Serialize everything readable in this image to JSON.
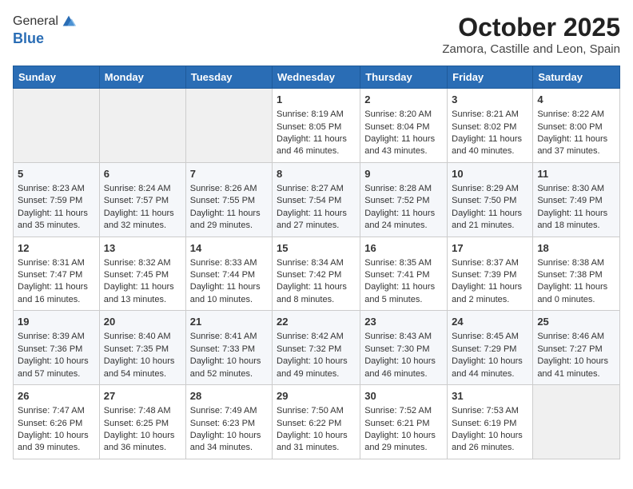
{
  "header": {
    "logo_line1": "General",
    "logo_line2": "Blue",
    "month": "October 2025",
    "location": "Zamora, Castille and Leon, Spain"
  },
  "weekdays": [
    "Sunday",
    "Monday",
    "Tuesday",
    "Wednesday",
    "Thursday",
    "Friday",
    "Saturday"
  ],
  "weeks": [
    [
      {
        "day": "",
        "sunrise": "",
        "sunset": "",
        "daylight": ""
      },
      {
        "day": "",
        "sunrise": "",
        "sunset": "",
        "daylight": ""
      },
      {
        "day": "",
        "sunrise": "",
        "sunset": "",
        "daylight": ""
      },
      {
        "day": "1",
        "sunrise": "Sunrise: 8:19 AM",
        "sunset": "Sunset: 8:05 PM",
        "daylight": "Daylight: 11 hours and 46 minutes."
      },
      {
        "day": "2",
        "sunrise": "Sunrise: 8:20 AM",
        "sunset": "Sunset: 8:04 PM",
        "daylight": "Daylight: 11 hours and 43 minutes."
      },
      {
        "day": "3",
        "sunrise": "Sunrise: 8:21 AM",
        "sunset": "Sunset: 8:02 PM",
        "daylight": "Daylight: 11 hours and 40 minutes."
      },
      {
        "day": "4",
        "sunrise": "Sunrise: 8:22 AM",
        "sunset": "Sunset: 8:00 PM",
        "daylight": "Daylight: 11 hours and 37 minutes."
      }
    ],
    [
      {
        "day": "5",
        "sunrise": "Sunrise: 8:23 AM",
        "sunset": "Sunset: 7:59 PM",
        "daylight": "Daylight: 11 hours and 35 minutes."
      },
      {
        "day": "6",
        "sunrise": "Sunrise: 8:24 AM",
        "sunset": "Sunset: 7:57 PM",
        "daylight": "Daylight: 11 hours and 32 minutes."
      },
      {
        "day": "7",
        "sunrise": "Sunrise: 8:26 AM",
        "sunset": "Sunset: 7:55 PM",
        "daylight": "Daylight: 11 hours and 29 minutes."
      },
      {
        "day": "8",
        "sunrise": "Sunrise: 8:27 AM",
        "sunset": "Sunset: 7:54 PM",
        "daylight": "Daylight: 11 hours and 27 minutes."
      },
      {
        "day": "9",
        "sunrise": "Sunrise: 8:28 AM",
        "sunset": "Sunset: 7:52 PM",
        "daylight": "Daylight: 11 hours and 24 minutes."
      },
      {
        "day": "10",
        "sunrise": "Sunrise: 8:29 AM",
        "sunset": "Sunset: 7:50 PM",
        "daylight": "Daylight: 11 hours and 21 minutes."
      },
      {
        "day": "11",
        "sunrise": "Sunrise: 8:30 AM",
        "sunset": "Sunset: 7:49 PM",
        "daylight": "Daylight: 11 hours and 18 minutes."
      }
    ],
    [
      {
        "day": "12",
        "sunrise": "Sunrise: 8:31 AM",
        "sunset": "Sunset: 7:47 PM",
        "daylight": "Daylight: 11 hours and 16 minutes."
      },
      {
        "day": "13",
        "sunrise": "Sunrise: 8:32 AM",
        "sunset": "Sunset: 7:45 PM",
        "daylight": "Daylight: 11 hours and 13 minutes."
      },
      {
        "day": "14",
        "sunrise": "Sunrise: 8:33 AM",
        "sunset": "Sunset: 7:44 PM",
        "daylight": "Daylight: 11 hours and 10 minutes."
      },
      {
        "day": "15",
        "sunrise": "Sunrise: 8:34 AM",
        "sunset": "Sunset: 7:42 PM",
        "daylight": "Daylight: 11 hours and 8 minutes."
      },
      {
        "day": "16",
        "sunrise": "Sunrise: 8:35 AM",
        "sunset": "Sunset: 7:41 PM",
        "daylight": "Daylight: 11 hours and 5 minutes."
      },
      {
        "day": "17",
        "sunrise": "Sunrise: 8:37 AM",
        "sunset": "Sunset: 7:39 PM",
        "daylight": "Daylight: 11 hours and 2 minutes."
      },
      {
        "day": "18",
        "sunrise": "Sunrise: 8:38 AM",
        "sunset": "Sunset: 7:38 PM",
        "daylight": "Daylight: 11 hours and 0 minutes."
      }
    ],
    [
      {
        "day": "19",
        "sunrise": "Sunrise: 8:39 AM",
        "sunset": "Sunset: 7:36 PM",
        "daylight": "Daylight: 10 hours and 57 minutes."
      },
      {
        "day": "20",
        "sunrise": "Sunrise: 8:40 AM",
        "sunset": "Sunset: 7:35 PM",
        "daylight": "Daylight: 10 hours and 54 minutes."
      },
      {
        "day": "21",
        "sunrise": "Sunrise: 8:41 AM",
        "sunset": "Sunset: 7:33 PM",
        "daylight": "Daylight: 10 hours and 52 minutes."
      },
      {
        "day": "22",
        "sunrise": "Sunrise: 8:42 AM",
        "sunset": "Sunset: 7:32 PM",
        "daylight": "Daylight: 10 hours and 49 minutes."
      },
      {
        "day": "23",
        "sunrise": "Sunrise: 8:43 AM",
        "sunset": "Sunset: 7:30 PM",
        "daylight": "Daylight: 10 hours and 46 minutes."
      },
      {
        "day": "24",
        "sunrise": "Sunrise: 8:45 AM",
        "sunset": "Sunset: 7:29 PM",
        "daylight": "Daylight: 10 hours and 44 minutes."
      },
      {
        "day": "25",
        "sunrise": "Sunrise: 8:46 AM",
        "sunset": "Sunset: 7:27 PM",
        "daylight": "Daylight: 10 hours and 41 minutes."
      }
    ],
    [
      {
        "day": "26",
        "sunrise": "Sunrise: 7:47 AM",
        "sunset": "Sunset: 6:26 PM",
        "daylight": "Daylight: 10 hours and 39 minutes."
      },
      {
        "day": "27",
        "sunrise": "Sunrise: 7:48 AM",
        "sunset": "Sunset: 6:25 PM",
        "daylight": "Daylight: 10 hours and 36 minutes."
      },
      {
        "day": "28",
        "sunrise": "Sunrise: 7:49 AM",
        "sunset": "Sunset: 6:23 PM",
        "daylight": "Daylight: 10 hours and 34 minutes."
      },
      {
        "day": "29",
        "sunrise": "Sunrise: 7:50 AM",
        "sunset": "Sunset: 6:22 PM",
        "daylight": "Daylight: 10 hours and 31 minutes."
      },
      {
        "day": "30",
        "sunrise": "Sunrise: 7:52 AM",
        "sunset": "Sunset: 6:21 PM",
        "daylight": "Daylight: 10 hours and 29 minutes."
      },
      {
        "day": "31",
        "sunrise": "Sunrise: 7:53 AM",
        "sunset": "Sunset: 6:19 PM",
        "daylight": "Daylight: 10 hours and 26 minutes."
      },
      {
        "day": "",
        "sunrise": "",
        "sunset": "",
        "daylight": ""
      }
    ]
  ]
}
